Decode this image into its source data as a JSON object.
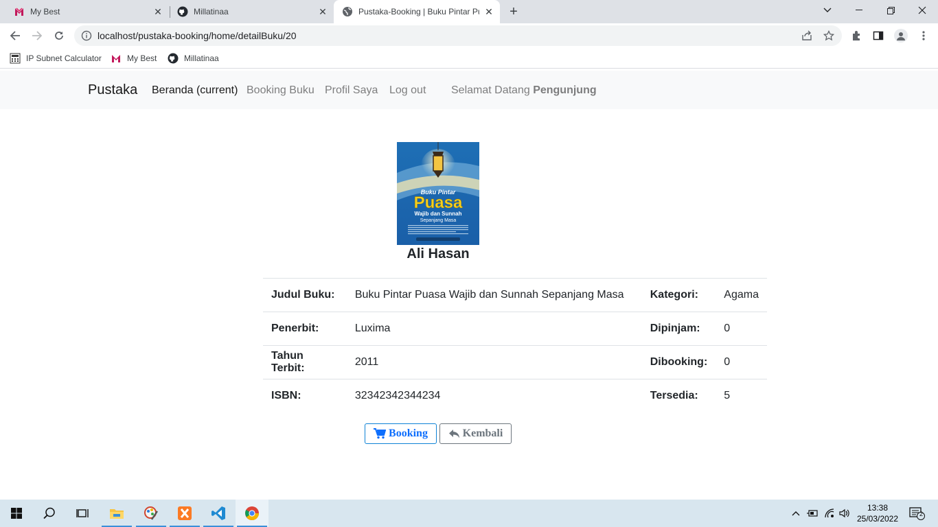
{
  "browser": {
    "tabs": [
      {
        "title": "My Best",
        "icon": "my-best-icon"
      },
      {
        "title": "Millatinaa",
        "icon": "github-icon"
      },
      {
        "title": "Pustaka-Booking | Buku Pintar Pu",
        "icon": "globe-icon",
        "active": true
      }
    ],
    "url": "localhost/pustaka-booking/home/detailBuku/20",
    "bookmarks": [
      {
        "label": "IP Subnet Calculator",
        "icon": "calculator-icon"
      },
      {
        "label": "My Best",
        "icon": "my-best-icon"
      },
      {
        "label": "Millatinaa",
        "icon": "github-icon"
      }
    ]
  },
  "navbar": {
    "brand": "Pustaka",
    "links": [
      "Beranda (current)",
      "Booking Buku",
      "Profil Saya",
      "Log out"
    ],
    "welcome_prefix": "Selamat Datang",
    "welcome_user": "Pengunjung"
  },
  "book": {
    "author": "Ali Hasan",
    "cover": {
      "title_line1": "Buku Pintar",
      "title_line2": "Puasa",
      "title_line3": "Wajib dan Sunnah",
      "title_line4": "Sepanjang Masa"
    },
    "details": [
      {
        "label1": "Judul Buku:",
        "value1": "Buku Pintar Puasa Wajib dan Sunnah Sepanjang Masa",
        "label2": "Kategori:",
        "value2": "Agama"
      },
      {
        "label1": "Penerbit:",
        "value1": "Luxima",
        "label2": "Dipinjam:",
        "value2": "0"
      },
      {
        "label1": "Tahun Terbit:",
        "value1": "2011",
        "label2": "Dibooking:",
        "value2": "0"
      },
      {
        "label1": "ISBN:",
        "value1": "32342342344234",
        "label2": "Tersedia:",
        "value2": "5"
      }
    ]
  },
  "actions": {
    "booking_label": "Booking",
    "back_label": "Kembali"
  },
  "taskbar": {
    "time": "13:38",
    "date": "25/03/2022",
    "notifications": "2"
  },
  "colors": {
    "primary": "#0d6efd",
    "secondary": "#6c757d",
    "navbar_bg": "#f8f9fa"
  }
}
